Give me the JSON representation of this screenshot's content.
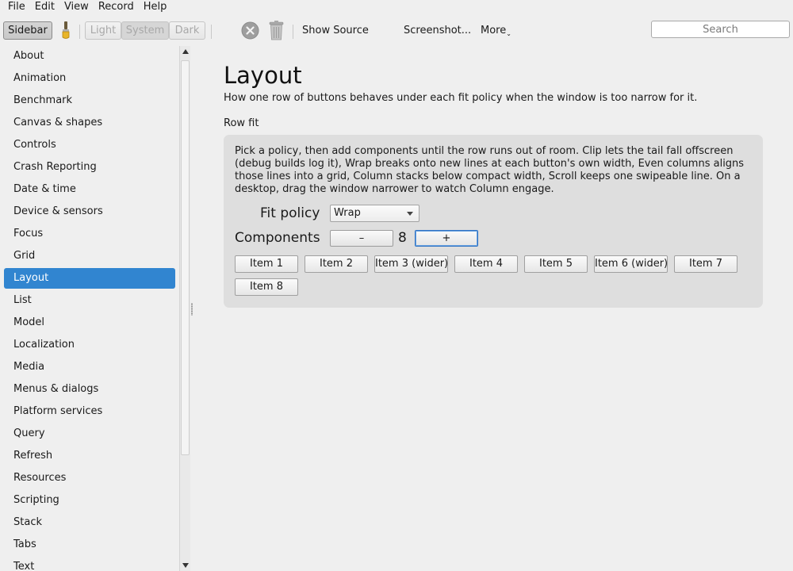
{
  "menubar": {
    "items": [
      "File",
      "Edit",
      "View",
      "Record",
      "Help"
    ]
  },
  "toolbar": {
    "sidebar_label": "Sidebar",
    "theme_icon": "paintbrush-icon",
    "theme_light": "Light",
    "theme_system": "System",
    "theme_dark": "Dark",
    "stop_icon": "close-circle-icon",
    "trash_icon": "trash-icon",
    "show_source": "Show Source",
    "screenshot": "Screenshot...",
    "more": "More",
    "more_caret": "⌄",
    "search_placeholder": "Search"
  },
  "sidebar": {
    "items": [
      "About",
      "Animation",
      "Benchmark",
      "Canvas & shapes",
      "Controls",
      "Crash Reporting",
      "Date & time",
      "Device & sensors",
      "Focus",
      "Grid",
      "Layout",
      "List",
      "Model",
      "Localization",
      "Media",
      "Menus & dialogs",
      "Platform services",
      "Query",
      "Refresh",
      "Resources",
      "Scripting",
      "Stack",
      "Tabs",
      "Text"
    ],
    "active": "Layout"
  },
  "main": {
    "title": "Layout",
    "subtitle": "How one row of buttons behaves under each fit policy when the window is too narrow for it.",
    "section_label": "Row fit",
    "description": "Pick a policy, then add components until the row runs out of room. Clip lets the tail fall offscreen (debug builds log it), Wrap breaks onto new lines at each button's own width, Even columns aligns those lines into a grid, Column stacks below compact width, Scroll keeps one swipeable line. On a desktop, drag the window narrower to watch Column engage.",
    "fit_policy_label": "Fit policy",
    "fit_policy_value": "Wrap",
    "components_label": "Components",
    "decrement_label": "–",
    "count": "8",
    "increment_label": "+",
    "items": [
      "Item 1",
      "Item 2",
      "Item 3 (wider)",
      "Item 4",
      "Item 5",
      "Item 6 (wider)",
      "Item 7",
      "Item 8"
    ]
  },
  "colors": {
    "accent": "#3185d0",
    "panel": "#dedede",
    "background": "#efefef"
  }
}
